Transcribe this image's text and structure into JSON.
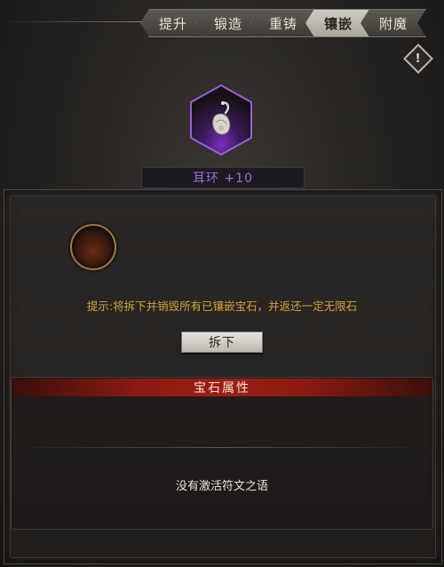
{
  "tabs": [
    {
      "label": "提升",
      "active": false
    },
    {
      "label": "锻造",
      "active": false
    },
    {
      "label": "重铸",
      "active": false
    },
    {
      "label": "镶嵌",
      "active": true
    },
    {
      "label": "附魔",
      "active": false
    }
  ],
  "info_icon": {
    "glyph": "!"
  },
  "item": {
    "name": "耳环 +10",
    "icon": "earring-icon",
    "rarity_color": "#a46ad8"
  },
  "socket": {
    "state": "empty"
  },
  "hint_text": "提示:将拆下并销毁所有已镶嵌宝石，并返还一定无限石",
  "remove_button_label": "拆下",
  "gem_attributes": {
    "header": "宝石属性"
  },
  "runeword_text": "没有激活符文之语",
  "colors": {
    "accent_purple": "#a46ad8",
    "hint_gold": "#d4a23a",
    "header_red": "#9c1f15"
  }
}
